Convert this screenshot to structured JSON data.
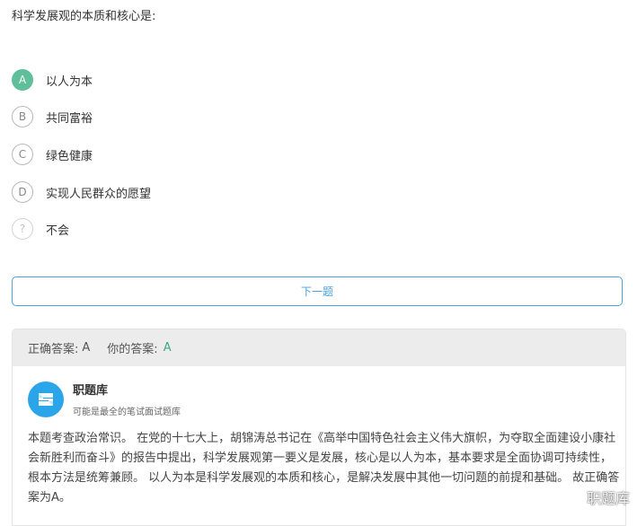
{
  "question": {
    "text": "科学发展观的本质和核心是:"
  },
  "options": [
    {
      "letter": "A",
      "text": "以人为本",
      "selected": true
    },
    {
      "letter": "B",
      "text": "共同富裕",
      "selected": false
    },
    {
      "letter": "C",
      "text": "绿色健康",
      "selected": false
    },
    {
      "letter": "D",
      "text": "实现人民群众的愿望",
      "selected": false
    },
    {
      "letter": "?",
      "text": "不会",
      "selected": false
    }
  ],
  "next_button": {
    "label": "下一题"
  },
  "answer": {
    "correct_label": "正确答案:",
    "correct_value": "A",
    "your_label": "你的答案:",
    "your_value": "A"
  },
  "source": {
    "name": "职题库",
    "description": "可能是最全的笔试面试题库",
    "logo_icon": "s-logo-icon",
    "logo_color": "#2aa5ea"
  },
  "explanation": "本题考查政治常识。 在党的十七大上，胡锦涛总书记在《高举中国特色社会主义伟大旗帜，为夺取全面建设小康社会新胜利而奋斗》的报告中提出，科学发展观第一要义是发展，核心是以人为本，基本要求是全面协调可持续性，根本方法是统筹兼顾。 以人为本是科学发展观的本质和核心，是解决发展中其他一切问题的前提和基础。 故正确答案为A。",
  "watermark": {
    "text": "职题库",
    "icon": "weibo-icon"
  },
  "colors": {
    "selected_option": "#5fbf9a",
    "accent_blue": "#4aa3df",
    "answer_value": "#3aa98a",
    "answer_bar_bg": "#ececec"
  }
}
